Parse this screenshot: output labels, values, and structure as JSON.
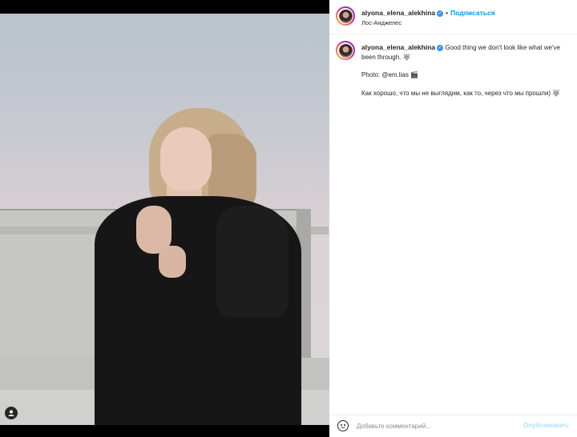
{
  "post": {
    "username": "alyona_elena_alekhina",
    "verified_glyph": "✓",
    "separator": "•",
    "follow_label": "Подписаться",
    "location": "Лос-Анджелес",
    "more_glyph": "•••"
  },
  "caption": {
    "username": "alyona_elena_alekhina",
    "text_en": "Good thing we don't look like what we've been through. 🐺",
    "photo_credit": "Photo: @em.lias 🎬",
    "text_ru": "Как хорошо, что мы не выглядим, как то, через что мы прошли) 🐺"
  },
  "comment": {
    "placeholder": "Добавьте комментарий...",
    "post_label": "Опубликовать",
    "emoji_icon": "smiley-face-icon"
  },
  "colors": {
    "follow": "#0095f6",
    "verified": "#3897f0",
    "post_disabled": "#b2dffc"
  }
}
